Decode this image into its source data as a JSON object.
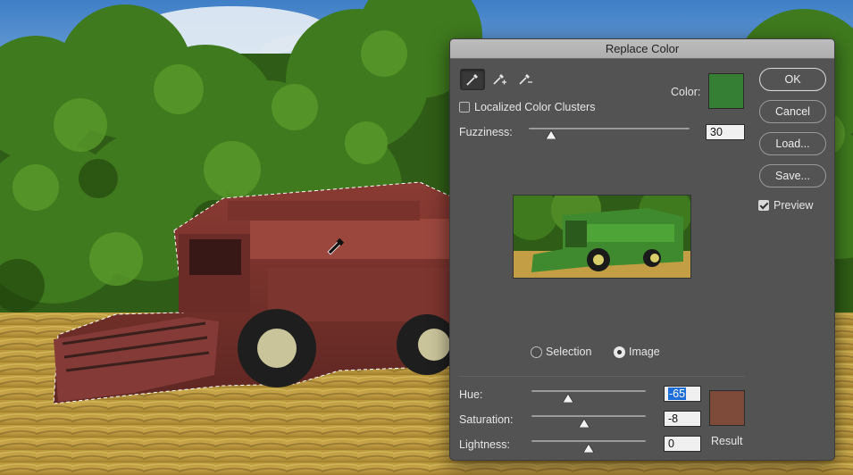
{
  "dialog": {
    "title": "Replace Color",
    "tools": [
      {
        "name": "eyedropper-icon",
        "active": true
      },
      {
        "name": "eyedropper-plus-icon",
        "active": false
      },
      {
        "name": "eyedropper-minus-icon",
        "active": false
      }
    ],
    "color_label": "Color:",
    "selected_color": "#357f35",
    "localized_clusters_label": "Localized Color Clusters",
    "localized_clusters_checked": false,
    "fuzziness_label": "Fuzziness:",
    "fuzziness_value": "30",
    "fuzziness_fraction": 0.14,
    "view_options": [
      {
        "label": "Selection",
        "checked": false
      },
      {
        "label": "Image",
        "checked": true
      }
    ],
    "hue_label": "Hue:",
    "hue_value": "-65",
    "hue_fraction": 0.32,
    "saturation_label": "Saturation:",
    "saturation_value": "-8",
    "saturation_fraction": 0.46,
    "lightness_label": "Lightness:",
    "lightness_value": "0",
    "lightness_fraction": 0.5,
    "result_label": "Result",
    "result_color": "#7e4a3a",
    "buttons": {
      "ok": "OK",
      "cancel": "Cancel",
      "load": "Load...",
      "save": "Save..."
    },
    "preview_label": "Preview",
    "preview_checked": true
  }
}
